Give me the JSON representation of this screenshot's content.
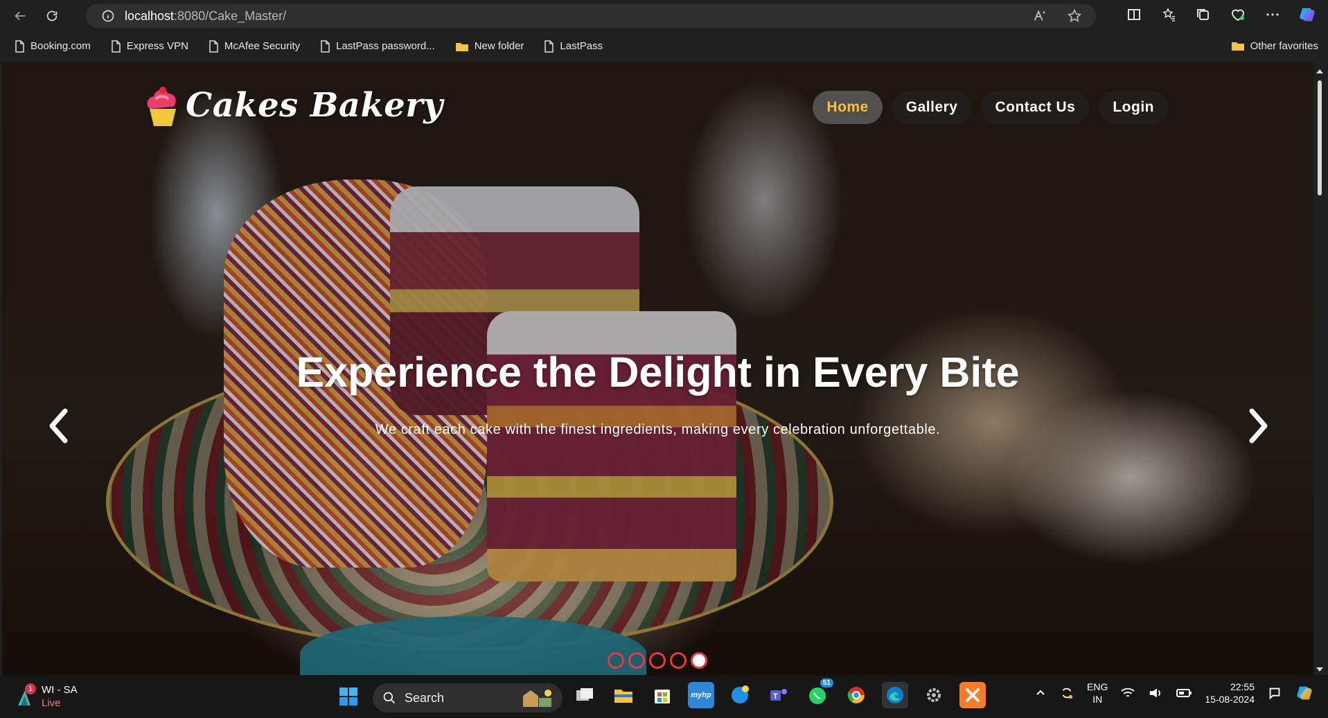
{
  "browser": {
    "url_host": "localhost",
    "url_rest": ":8080/Cake_Master/",
    "favorites": [
      {
        "label": "Booking.com"
      },
      {
        "label": "Express VPN"
      },
      {
        "label": "McAfee Security"
      },
      {
        "label": "LastPass password..."
      },
      {
        "label": "New folder"
      },
      {
        "label": "LastPass"
      }
    ],
    "other_favorites": "Other favorites"
  },
  "site": {
    "brand": "Cakes Bakery",
    "nav": [
      {
        "label": "Home",
        "active": true
      },
      {
        "label": "Gallery",
        "active": false
      },
      {
        "label": "Contact Us",
        "active": false
      },
      {
        "label": "Login",
        "active": false
      }
    ],
    "hero": {
      "title": "Experience the Delight in Every Bite",
      "subtitle": "We craft each cake with the finest ingredients, making every celebration unforgettable."
    },
    "carousel_active": 5,
    "carousel_count": 5
  },
  "taskbar": {
    "weather_name": "WI - SA",
    "weather_status": "Live",
    "weather_badge": "1",
    "search_placeholder": "Search",
    "whatsapp_badge": "51",
    "lang": "ENG",
    "region": "IN",
    "time": "22:55",
    "date": "15-08-2024"
  },
  "colors": {
    "accent": "#ffbf34",
    "carousel_dot": "#e93744"
  }
}
